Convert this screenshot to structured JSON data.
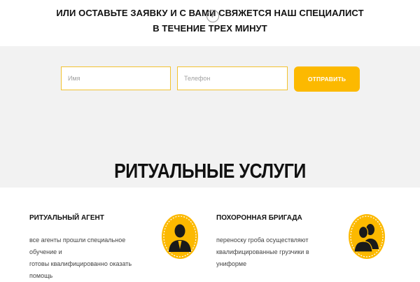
{
  "header": {
    "line1": "ИЛИ ОСТАВЬТЕ ЗАЯВКУ И С ВАМИ СВЯЖЕТСЯ НАШ СПЕЦИАЛИСТ",
    "line2": "В ТЕЧЕНИЕ ТРЕХ МИНУТ"
  },
  "form": {
    "name_placeholder": "Имя",
    "phone_placeholder": "Телефон",
    "submit_label": "ОТПРАВИТЬ"
  },
  "services": {
    "title": "РИТУАЛЬНЫЕ УСЛУГИ",
    "items": [
      {
        "title": "РИТУАЛЬНЫЙ АГЕНТ",
        "desc_line1": "все агенты прошли специальное обучение и",
        "desc_line2": "готовы квалифицированно оказать помощь",
        "icon": "agent-icon"
      },
      {
        "title": "ПОХОРОННАЯ БРИГАДА",
        "desc_line1": "переноску гроба осуществляют",
        "desc_line2": "квалифицированные грузчики в униформе",
        "icon": "team-icon"
      }
    ]
  },
  "colors": {
    "accent": "#fcb900",
    "field_border": "#f2c230",
    "band_bg": "#f2f2f2"
  }
}
